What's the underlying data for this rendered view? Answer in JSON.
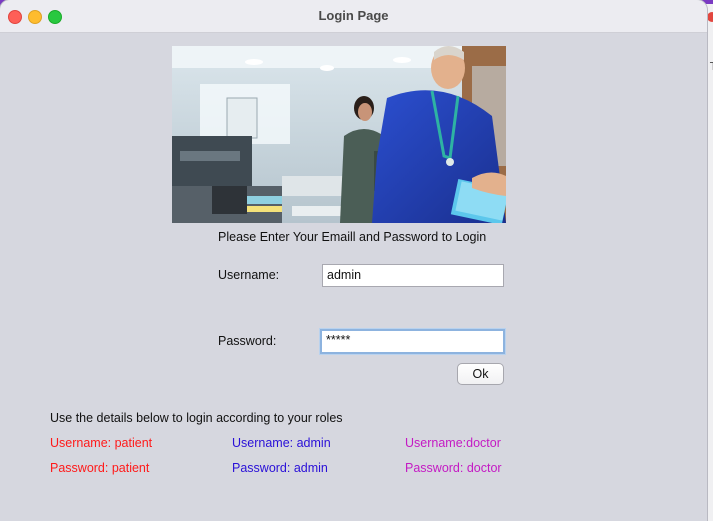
{
  "window": {
    "title": "Login Page"
  },
  "photo": {
    "description": "hospital-photo"
  },
  "form": {
    "heading": "Please Enter Your Emaill and Password to Login",
    "username_label": "Username:",
    "username_value": "admin",
    "password_label": "Password:",
    "password_value": "*****",
    "ok_label": "Ok"
  },
  "credentials": {
    "heading": "Use the details below to login according to your roles",
    "patient": {
      "username": "Username: patient",
      "password": "Password: patient"
    },
    "admin": {
      "username": "Username: admin",
      "password": "Password: admin"
    },
    "doctor": {
      "username": "Username:doctor",
      "password": "Password: doctor"
    }
  },
  "colors": {
    "patient": "#ff1a1a",
    "admin": "#2a10d8",
    "doctor": "#c41ac4",
    "window_bg": "#d6d7df",
    "titlebar_bg": "#ececf1"
  }
}
